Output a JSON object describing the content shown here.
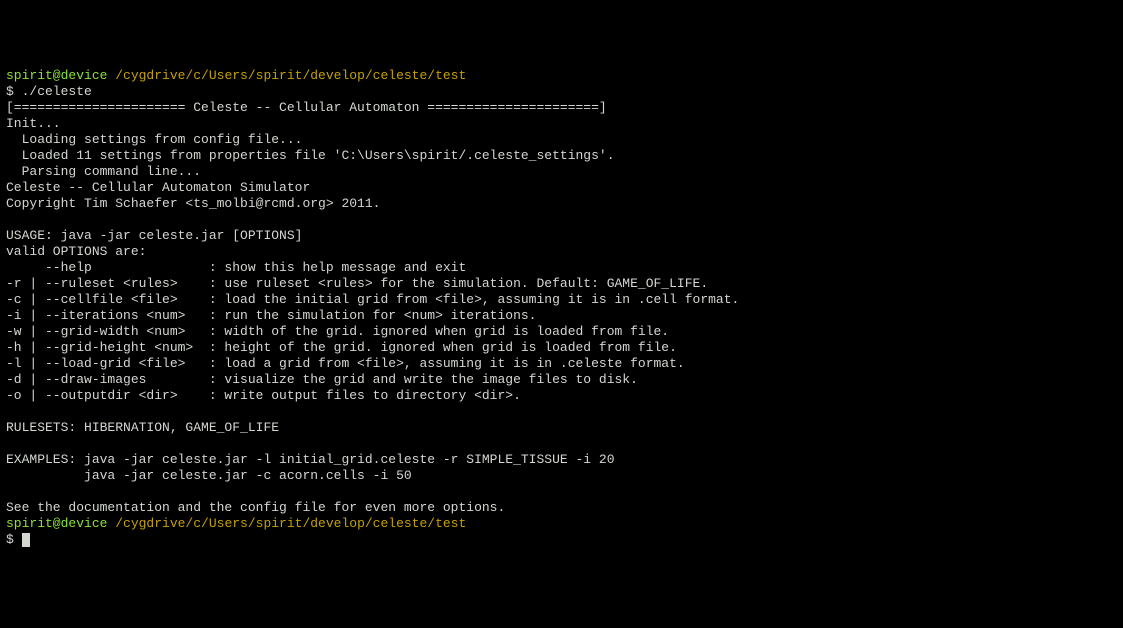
{
  "prompt1": {
    "user": "spirit@device",
    "path": " /cygdrive/c/Users/spirit/develop/celeste/test"
  },
  "cmd1": "$ ./celeste",
  "out": {
    "l1": "[====================== Celeste -- Cellular Automaton ======================]",
    "l2": "Init...",
    "l3": "  Loading settings from config file...",
    "l4": "  Loaded 11 settings from properties file 'C:\\Users\\spirit/.celeste_settings'.",
    "l5": "  Parsing command line...",
    "l6": "Celeste -- Cellular Automaton Simulator",
    "l7": "Copyright Tim Schaefer <ts_molbi@rcmd.org> 2011.",
    "l8": "",
    "l9": "USAGE: java -jar celeste.jar [OPTIONS]",
    "l10": "valid OPTIONS are:",
    "l11": "     --help               : show this help message and exit",
    "l12": "-r | --ruleset <rules>    : use ruleset <rules> for the simulation. Default: GAME_OF_LIFE.",
    "l13": "-c | --cellfile <file>    : load the initial grid from <file>, assuming it is in .cell format.",
    "l14": "-i | --iterations <num>   : run the simulation for <num> iterations.",
    "l15": "-w | --grid-width <num>   : width of the grid. ignored when grid is loaded from file.",
    "l16": "-h | --grid-height <num>  : height of the grid. ignored when grid is loaded from file.",
    "l17": "-l | --load-grid <file>   : load a grid from <file>, assuming it is in .celeste format.",
    "l18": "-d | --draw-images        : visualize the grid and write the image files to disk.",
    "l19": "-o | --outputdir <dir>    : write output files to directory <dir>.",
    "l20": "",
    "l21": "RULESETS: HIBERNATION, GAME_OF_LIFE",
    "l22": "",
    "l23": "EXAMPLES: java -jar celeste.jar -l initial_grid.celeste -r SIMPLE_TISSUE -i 20",
    "l24": "          java -jar celeste.jar -c acorn.cells -i 50",
    "l25": "",
    "l26": "See the documentation and the config file for even more options."
  },
  "prompt2": {
    "user": "spirit@device",
    "path": " /cygdrive/c/Users/spirit/develop/celeste/test"
  },
  "cmd2": "$ "
}
